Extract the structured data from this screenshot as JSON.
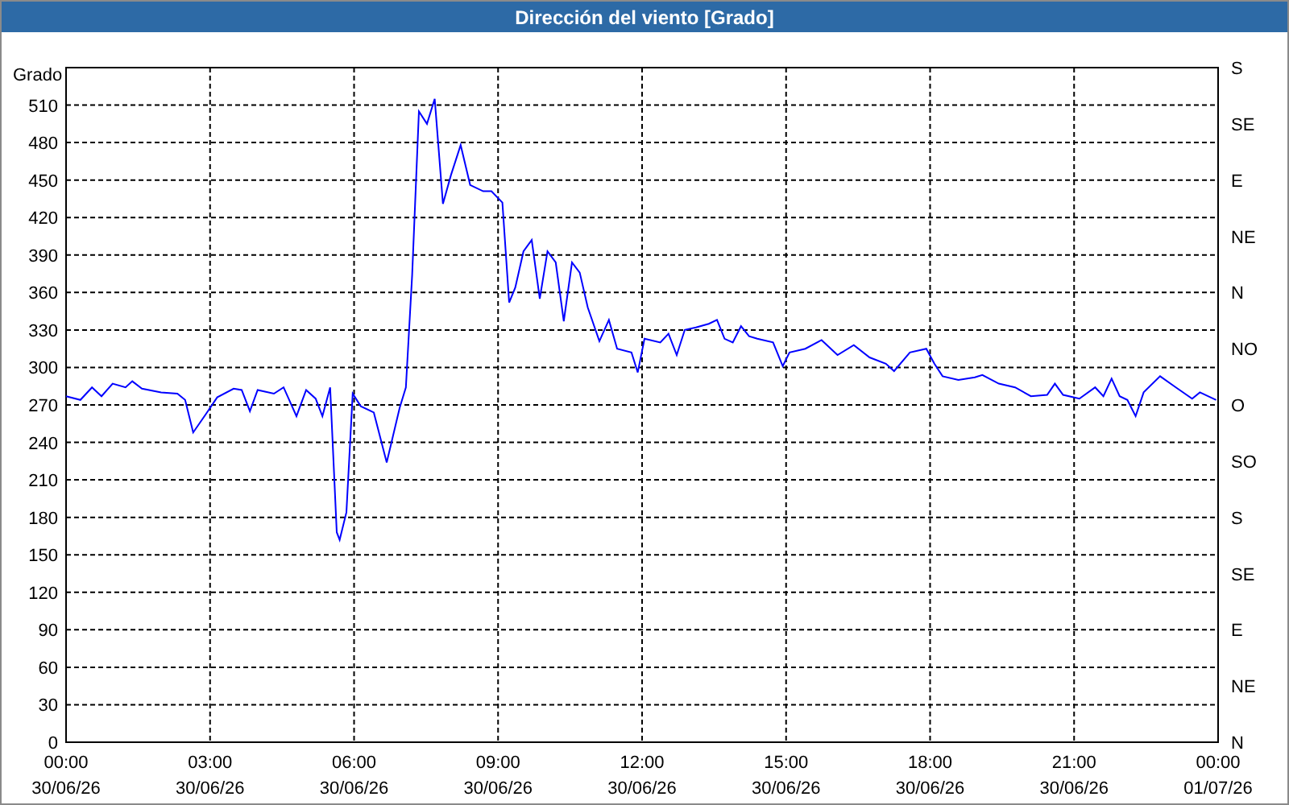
{
  "window": {
    "title": "Dirección del viento [Grado]"
  },
  "chart": {
    "chart_data": {
      "type": "line",
      "grid": true,
      "ylabel": "Grado",
      "xlim": [
        0,
        24
      ],
      "ylim": [
        0,
        540
      ],
      "yticks": [
        0,
        30,
        60,
        90,
        120,
        150,
        180,
        210,
        240,
        270,
        300,
        330,
        360,
        390,
        420,
        450,
        480,
        510
      ],
      "xticks": [
        {
          "value": 0,
          "label": "00:00"
        },
        {
          "value": 3,
          "label": "03:00"
        },
        {
          "value": 6,
          "label": "06:00"
        },
        {
          "value": 9,
          "label": "09:00"
        },
        {
          "value": 12,
          "label": "12:00"
        },
        {
          "value": 15,
          "label": "15:00"
        },
        {
          "value": 18,
          "label": "18:00"
        },
        {
          "value": 21,
          "label": "21:00"
        },
        {
          "value": 24,
          "label": "00:00"
        }
      ],
      "x": [
        0,
        0.3,
        0.54,
        0.74,
        0.97,
        1.24,
        1.38,
        1.58,
        1.98,
        2.32,
        2.48,
        2.65,
        2.92,
        3.15,
        3.49,
        3.66,
        3.83,
        3.99,
        4.33,
        4.53,
        4.8,
        5.0,
        5.2,
        5.34,
        5.5,
        5.64,
        5.7,
        5.84,
        5.97,
        6.14,
        6.41,
        6.68,
        6.95,
        7.08,
        7.21,
        7.35,
        7.52,
        7.68,
        7.85,
        8.02,
        8.22,
        8.42,
        8.69,
        8.86,
        9.09,
        9.23,
        9.36,
        9.53,
        9.7,
        9.87,
        10.03,
        10.2,
        10.37,
        10.54,
        10.7,
        10.87,
        11.11,
        11.31,
        11.48,
        11.78,
        11.91,
        12.05,
        12.38,
        12.55,
        12.72,
        12.89,
        13.12,
        13.39,
        13.56,
        13.72,
        13.89,
        14.06,
        14.23,
        14.4,
        14.73,
        14.93,
        15.07,
        15.4,
        15.74,
        16.07,
        16.41,
        16.74,
        17.08,
        17.25,
        17.58,
        17.92,
        18.09,
        18.26,
        18.59,
        18.93,
        19.09,
        19.43,
        19.77,
        20.1,
        20.44,
        20.6,
        20.77,
        21.11,
        21.44,
        21.61,
        21.78,
        21.95,
        22.11,
        22.28,
        22.45,
        22.79,
        23.12,
        23.46,
        23.62,
        23.96
      ],
      "series": [
        {
          "color": "#0000ff",
          "values": [
            277,
            274,
            284,
            277,
            287,
            284,
            289,
            283,
            280,
            279,
            274,
            248,
            263,
            276,
            283,
            282,
            265,
            282,
            279,
            284,
            261,
            282,
            275,
            261,
            284,
            168,
            162,
            184,
            279,
            269,
            264,
            224,
            268,
            284,
            374,
            505,
            495,
            515,
            431,
            454,
            478,
            446,
            441,
            441,
            432,
            352,
            364,
            393,
            402,
            355,
            393,
            384,
            337,
            384,
            376,
            348,
            321,
            338,
            315,
            312,
            296,
            323,
            320,
            327,
            310,
            330,
            332,
            335,
            338,
            323,
            320,
            333,
            325,
            323,
            320,
            301,
            312,
            315,
            322,
            310,
            318,
            308,
            303,
            297,
            312,
            315,
            303,
            293,
            290,
            292,
            294,
            287,
            284,
            277,
            278,
            287,
            278,
            275,
            284,
            277,
            291,
            277,
            274,
            261,
            280,
            293,
            284,
            275,
            280,
            274
          ]
        }
      ]
    },
    "x_dates": [
      "30/06/26",
      "30/06/26",
      "30/06/26",
      "30/06/26",
      "30/06/26",
      "30/06/26",
      "30/06/26",
      "30/06/26",
      "01/07/26"
    ],
    "compass_labels": [
      "S",
      "SE",
      "E",
      "NE",
      "N",
      "NO",
      "O",
      "SO",
      "S",
      "SE",
      "E",
      "NE",
      "N"
    ]
  }
}
